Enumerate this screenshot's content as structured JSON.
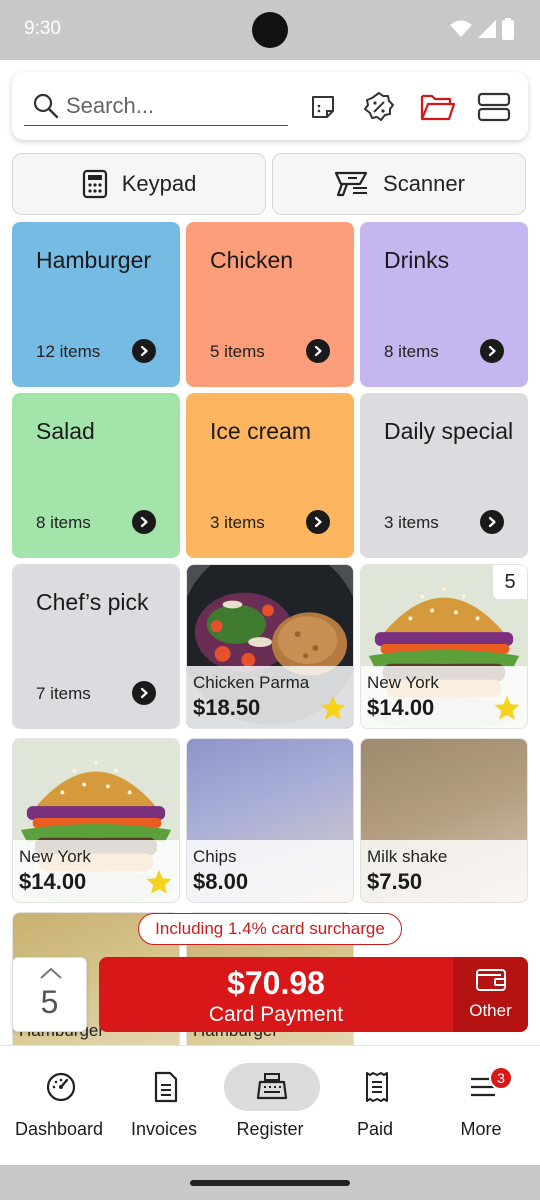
{
  "status_bar": {
    "time": "9:30"
  },
  "search": {
    "placeholder": "Search..."
  },
  "toolbar_icons": [
    "note-icon",
    "discount-icon",
    "folder-icon",
    "layout-icon"
  ],
  "modes": [
    {
      "label": "Keypad",
      "icon": "calculator-icon"
    },
    {
      "label": "Scanner",
      "icon": "barcode-scanner-icon"
    }
  ],
  "categories": [
    {
      "name": "Hamburger",
      "count": "12 items",
      "color": "#76bbe4"
    },
    {
      "name": "Chicken",
      "count": "5 items",
      "color": "#fc9e7a"
    },
    {
      "name": "Drinks",
      "count": "8 items",
      "color": "#c5b6ef"
    },
    {
      "name": "Salad",
      "count": "8 items",
      "color": "#a3e4ab"
    },
    {
      "name": "Ice cream",
      "count": "3 items",
      "color": "#fdb55f"
    },
    {
      "name": "Daily special",
      "count": "3 items",
      "color": "#dcdbe0"
    },
    {
      "name": "Chef’s pick",
      "count": "7 items",
      "color": "#dcdbe0"
    }
  ],
  "products": [
    {
      "name": "Chicken Parma",
      "price": "$18.50",
      "favorite": true,
      "badge": "",
      "image": "chicken-parma-photo"
    },
    {
      "name": "New York",
      "price": "$14.00",
      "favorite": true,
      "badge": "5",
      "image": "burger-photo"
    },
    {
      "name": "New York",
      "price": "$14.00",
      "favorite": true,
      "badge": "",
      "image": "burger-photo"
    },
    {
      "name": "Chips",
      "price": "$8.00",
      "favorite": false,
      "badge": "",
      "image": "chips-photo-blurred"
    },
    {
      "name": "Milk shake",
      "price": "$7.50",
      "favorite": false,
      "badge": "",
      "image": "milkshake-photo-blurred"
    },
    {
      "name": "Hamburger",
      "price": "",
      "favorite": false,
      "badge": "",
      "image": "partially-hidden-tile"
    },
    {
      "name": "Hamburger",
      "price": "",
      "favorite": false,
      "badge": "",
      "image": "partially-hidden-tile"
    }
  ],
  "checkout": {
    "surcharge_note": "Including 1.4% card surcharge",
    "quantity": "5",
    "amount": "$70.98",
    "method": "Card Payment",
    "other_label": "Other"
  },
  "bottom_nav": [
    {
      "label": "Dashboard",
      "icon": "dashboard-icon",
      "active": false
    },
    {
      "label": "Invoices",
      "icon": "invoice-icon",
      "active": false
    },
    {
      "label": "Register",
      "icon": "cash-register-icon",
      "active": true
    },
    {
      "label": "Paid",
      "icon": "receipt-icon",
      "active": false
    },
    {
      "label": "More",
      "icon": "menu-icon",
      "active": false,
      "badge": "3"
    }
  ],
  "colors": {
    "accent": "#d81818",
    "accent_dark": "#b51212"
  }
}
